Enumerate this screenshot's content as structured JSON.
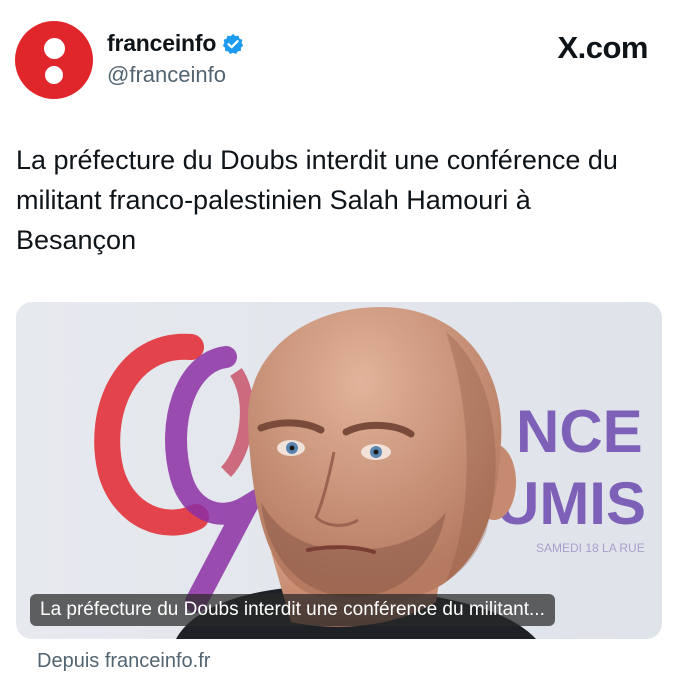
{
  "account": {
    "display_name": "franceinfo",
    "handle": "@franceinfo",
    "verified": true,
    "avatar_color": "#e0262b"
  },
  "brand": {
    "site": "X.com"
  },
  "tweet": {
    "text": "La préfecture du Doubs interdit une conférence du militant franco-palestinien Salah Hamouri à Besançon"
  },
  "media_card": {
    "caption": "La préfecture du Doubs interdit une conférence du militant...",
    "background_sign_text": "NCE UMIS",
    "source": "Depuis franceinfo.fr"
  },
  "colors": {
    "verified_blue": "#1d9bf0",
    "secondary_text": "#536471"
  }
}
